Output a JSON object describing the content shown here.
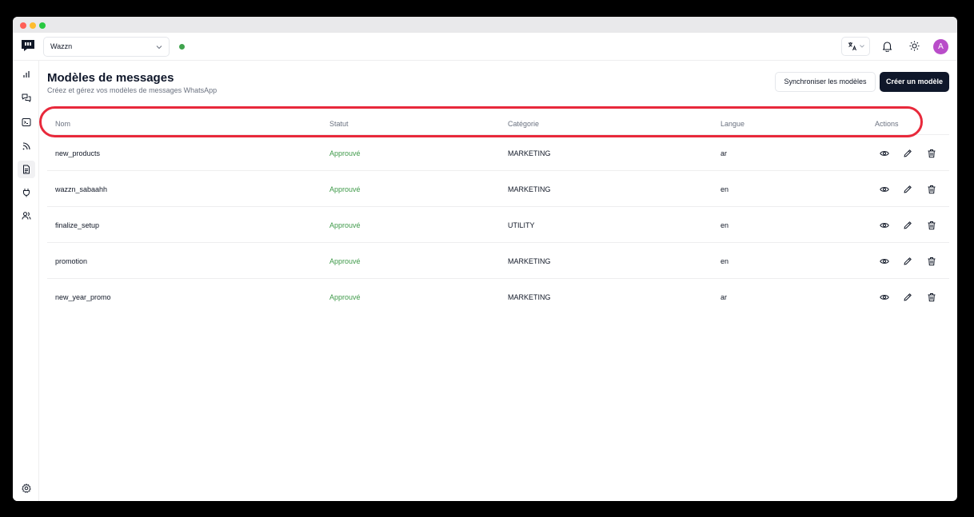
{
  "workspace": {
    "name": "Wazzn"
  },
  "user": {
    "initial": "A"
  },
  "colors": {
    "accent": "#0f172a",
    "approved": "#3f9a4a",
    "highlight": "#e8293b",
    "avatar": "#b94dc9",
    "online": "#3fa34d"
  },
  "page": {
    "title": "Modèles de messages",
    "subtitle": "Créez et gérez vos modèles de messages WhatsApp",
    "sync_label": "Synchroniser les modèles",
    "create_label": "Créer un modèle"
  },
  "sidebar": {
    "items": [
      {
        "name": "analytics",
        "icon": "bar-chart-icon"
      },
      {
        "name": "conversations",
        "icon": "chat-icon"
      },
      {
        "name": "console",
        "icon": "terminal-icon"
      },
      {
        "name": "broadcast",
        "icon": "rss-icon"
      },
      {
        "name": "templates",
        "icon": "document-icon",
        "active": true
      },
      {
        "name": "integrations",
        "icon": "plug-icon"
      },
      {
        "name": "contacts",
        "icon": "users-icon"
      }
    ],
    "settings_icon": "gear-icon"
  },
  "table": {
    "headers": {
      "name": "Nom",
      "status": "Statut",
      "category": "Catégorie",
      "language": "Langue",
      "actions": "Actions"
    },
    "rows": [
      {
        "name": "new_products",
        "status": "Approuvé",
        "category": "MARKETING",
        "language": "ar"
      },
      {
        "name": "wazzn_sabaahh",
        "status": "Approuvé",
        "category": "MARKETING",
        "language": "en"
      },
      {
        "name": "finalize_setup",
        "status": "Approuvé",
        "category": "UTILITY",
        "language": "en"
      },
      {
        "name": "promotion",
        "status": "Approuvé",
        "category": "MARKETING",
        "language": "en"
      },
      {
        "name": "new_year_promo",
        "status": "Approuvé",
        "category": "MARKETING",
        "language": "ar"
      }
    ]
  }
}
